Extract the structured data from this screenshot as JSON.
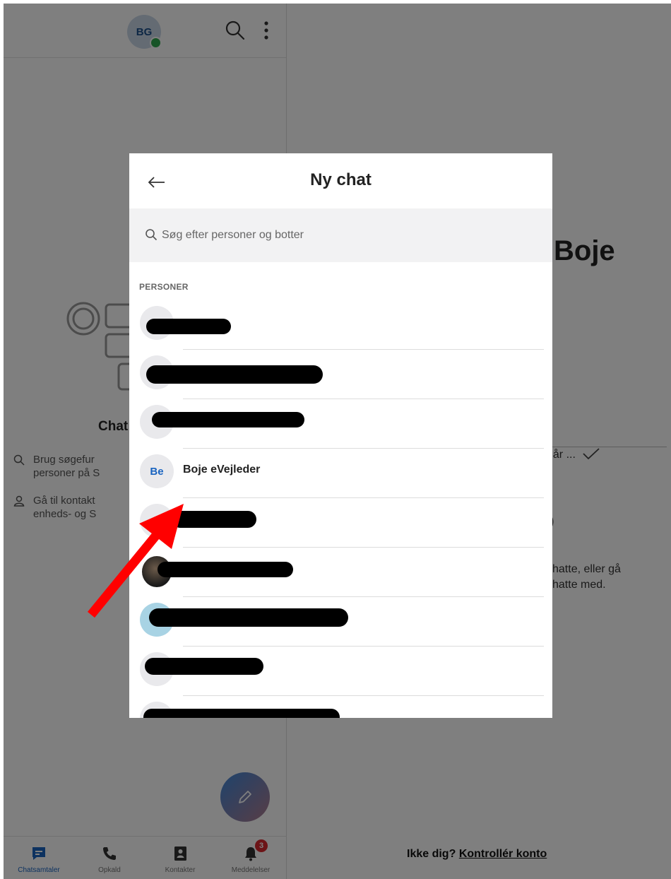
{
  "header": {
    "avatar_initials": "BG",
    "search_icon": "search-icon",
    "more_icon": "more-vertical-icon"
  },
  "left_pane": {
    "empty_heading": "Chat",
    "tips": [
      {
        "icon": "search-icon",
        "line1": "Brug søgefur",
        "line2": "personer på S"
      },
      {
        "icon": "person-icon",
        "line1": "Gå til kontakt",
        "line2": "enheds- og S"
      }
    ]
  },
  "bottom_nav": [
    {
      "label": "Chatsamtaler",
      "icon": "chat-icon",
      "active": true
    },
    {
      "label": "Opkald",
      "icon": "phone-icon",
      "active": false
    },
    {
      "label": "Kontakter",
      "icon": "contacts-icon",
      "active": false
    },
    {
      "label": "Meddelelser",
      "icon": "bell-icon",
      "active": false,
      "badge": "3"
    }
  ],
  "right_pane": {
    "title": "Boje",
    "yesterday": "går ...",
    "glyph": ")",
    "text_line1": "chatte, eller gå",
    "text_line2": "chatte med.",
    "footer_prefix": "Ikke dig?",
    "footer_link": "Kontrollér konto"
  },
  "dialog": {
    "title": "Ny chat",
    "search_placeholder": "Søg efter personer og botter",
    "section_label": "PERSONER",
    "contact": {
      "initials": "Be",
      "name": "Boje eVejleder"
    }
  },
  "colors": {
    "accent": "#1a64c0",
    "badge": "#d9282f",
    "presence": "#2fa84f",
    "arrow": "#ff0000"
  }
}
